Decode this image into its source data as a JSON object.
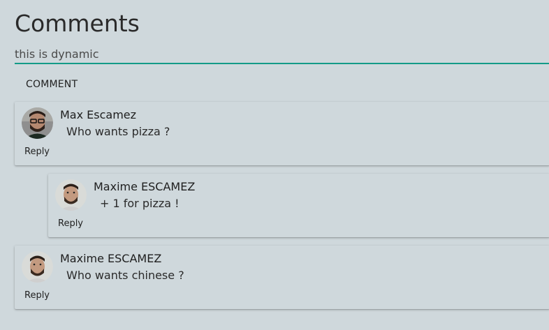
{
  "header": {
    "title": "Comments"
  },
  "composer": {
    "value": "this is dynamic",
    "button_label": "COMMENT"
  },
  "comments": [
    {
      "author": "Max Escamez",
      "text": "Who wants pizza ?",
      "reply_label": "Reply",
      "avatar": "avatar-photo"
    },
    {
      "author": "Maxime ESCAMEZ",
      "text": "+ 1 for pizza !",
      "reply_label": "Reply",
      "avatar": "avatar-photo"
    },
    {
      "author": "Maxime ESCAMEZ",
      "text": "Who wants chinese ?",
      "reply_label": "Reply",
      "avatar": "avatar-photo"
    }
  ],
  "colors": {
    "background": "#cfd8dc",
    "accent": "#139b87"
  }
}
